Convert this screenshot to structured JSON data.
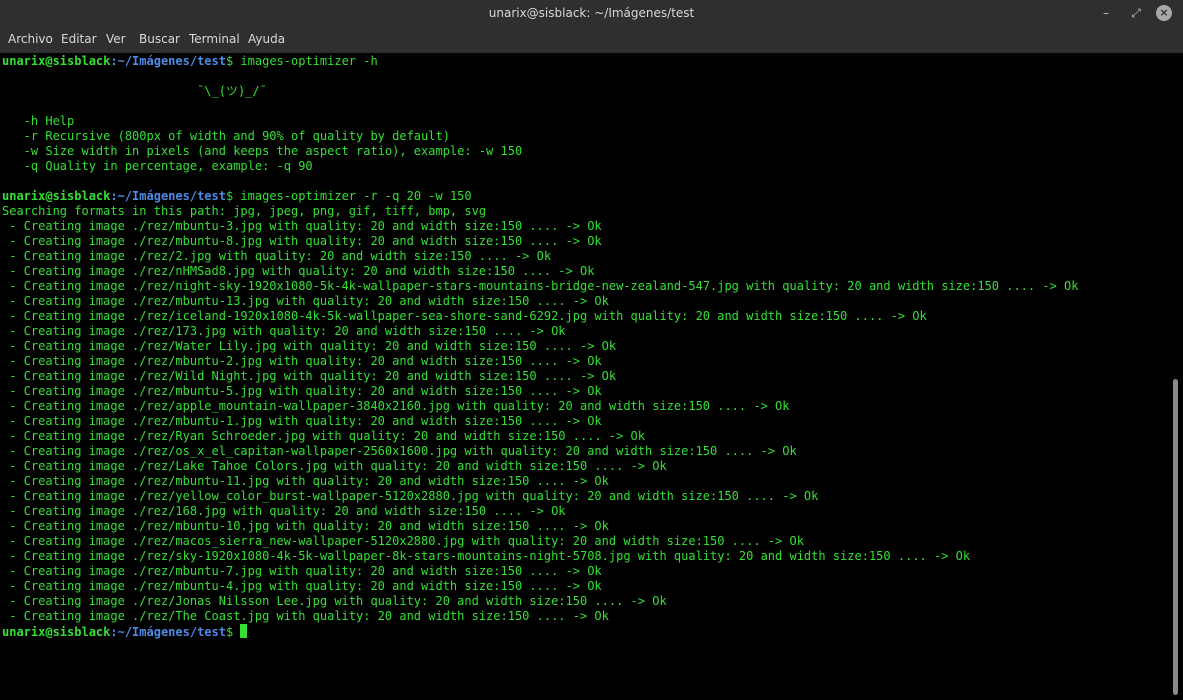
{
  "window": {
    "title": "unarix@sisblack: ~/Imágenes/test",
    "minimize_glyph": "–",
    "maximize_glyph": "⤢",
    "close_glyph": "×"
  },
  "menu": [
    "Archivo",
    "Editar",
    "Ver",
    "Buscar",
    "Terminal",
    "Ayuda"
  ],
  "prompt": {
    "user_host": "unarix@sisblack",
    "path": ":~/Imágenes/test",
    "symbol": "$"
  },
  "lines": [
    {
      "kind": "cmd",
      "text": " images-optimizer -h"
    },
    {
      "kind": "out",
      "text": ""
    },
    {
      "kind": "out",
      "text": "                           ¯\\_(ツ)_/¯"
    },
    {
      "kind": "out",
      "text": ""
    },
    {
      "kind": "out",
      "text": "   -h Help"
    },
    {
      "kind": "out",
      "text": "   -r Recursive (800px of width and 90% of quality by default)"
    },
    {
      "kind": "out",
      "text": "   -w Size width in pixels (and keeps the aspect ratio), example: -w 150"
    },
    {
      "kind": "out",
      "text": "   -q Quality in percentage, example: -q 90"
    },
    {
      "kind": "out",
      "text": ""
    },
    {
      "kind": "cmd",
      "text": " images-optimizer -r -q 20 -w 150"
    },
    {
      "kind": "out",
      "text": "Searching formats in this path: jpg, jpeg, png, gif, tiff, bmp, svg"
    },
    {
      "kind": "out",
      "text": " - Creating image ./rez/mbuntu-3.jpg with quality: 20 and width size:150 .... -> Ok"
    },
    {
      "kind": "out",
      "text": " - Creating image ./rez/mbuntu-8.jpg with quality: 20 and width size:150 .... -> Ok"
    },
    {
      "kind": "out",
      "text": " - Creating image ./rez/2.jpg with quality: 20 and width size:150 .... -> Ok"
    },
    {
      "kind": "out",
      "text": " - Creating image ./rez/nHMSad8.jpg with quality: 20 and width size:150 .... -> Ok"
    },
    {
      "kind": "out",
      "text": " - Creating image ./rez/night-sky-1920x1080-5k-4k-wallpaper-stars-mountains-bridge-new-zealand-547.jpg with quality: 20 and width size:150 .... -> Ok"
    },
    {
      "kind": "out",
      "text": " - Creating image ./rez/mbuntu-13.jpg with quality: 20 and width size:150 .... -> Ok"
    },
    {
      "kind": "out",
      "text": " - Creating image ./rez/iceland-1920x1080-4k-5k-wallpaper-sea-shore-sand-6292.jpg with quality: 20 and width size:150 .... -> Ok"
    },
    {
      "kind": "out",
      "text": " - Creating image ./rez/173.jpg with quality: 20 and width size:150 .... -> Ok"
    },
    {
      "kind": "out",
      "text": " - Creating image ./rez/Water Lily.jpg with quality: 20 and width size:150 .... -> Ok"
    },
    {
      "kind": "out",
      "text": " - Creating image ./rez/mbuntu-2.jpg with quality: 20 and width size:150 .... -> Ok"
    },
    {
      "kind": "out",
      "text": " - Creating image ./rez/Wild Night.jpg with quality: 20 and width size:150 .... -> Ok"
    },
    {
      "kind": "out",
      "text": " - Creating image ./rez/mbuntu-5.jpg with quality: 20 and width size:150 .... -> Ok"
    },
    {
      "kind": "out",
      "text": " - Creating image ./rez/apple_mountain-wallpaper-3840x2160.jpg with quality: 20 and width size:150 .... -> Ok"
    },
    {
      "kind": "out",
      "text": " - Creating image ./rez/mbuntu-1.jpg with quality: 20 and width size:150 .... -> Ok"
    },
    {
      "kind": "out",
      "text": " - Creating image ./rez/Ryan Schroeder.jpg with quality: 20 and width size:150 .... -> Ok"
    },
    {
      "kind": "out",
      "text": " - Creating image ./rez/os_x_el_capitan-wallpaper-2560x1600.jpg with quality: 20 and width size:150 .... -> Ok"
    },
    {
      "kind": "out",
      "text": " - Creating image ./rez/Lake Tahoe Colors.jpg with quality: 20 and width size:150 .... -> Ok"
    },
    {
      "kind": "out",
      "text": " - Creating image ./rez/mbuntu-11.jpg with quality: 20 and width size:150 .... -> Ok"
    },
    {
      "kind": "out",
      "text": " - Creating image ./rez/yellow_color_burst-wallpaper-5120x2880.jpg with quality: 20 and width size:150 .... -> Ok"
    },
    {
      "kind": "out",
      "text": " - Creating image ./rez/168.jpg with quality: 20 and width size:150 .... -> Ok"
    },
    {
      "kind": "out",
      "text": " - Creating image ./rez/mbuntu-10.jpg with quality: 20 and width size:150 .... -> Ok"
    },
    {
      "kind": "out",
      "text": " - Creating image ./rez/macos_sierra_new-wallpaper-5120x2880.jpg with quality: 20 and width size:150 .... -> Ok"
    },
    {
      "kind": "out",
      "text": " - Creating image ./rez/sky-1920x1080-4k-5k-wallpaper-8k-stars-mountains-night-5708.jpg with quality: 20 and width size:150 .... -> Ok"
    },
    {
      "kind": "out",
      "text": " - Creating image ./rez/mbuntu-7.jpg with quality: 20 and width size:150 .... -> Ok"
    },
    {
      "kind": "out",
      "text": " - Creating image ./rez/mbuntu-4.jpg with quality: 20 and width size:150 .... -> Ok"
    },
    {
      "kind": "out",
      "text": " - Creating image ./rez/Jonas Nilsson Lee.jpg with quality: 20 and width size:150 .... -> Ok"
    },
    {
      "kind": "out",
      "text": " - Creating image ./rez/The Coast.jpg with quality: 20 and width size:150 .... -> Ok"
    },
    {
      "kind": "prompt",
      "text": " "
    }
  ],
  "colors": {
    "terminal_bg": "#000000",
    "text_green": "#33e033",
    "path_blue": "#4d8be6",
    "chrome_bg": "#2f2f2f"
  },
  "scrollbar": {
    "position_fraction": 1.0
  }
}
